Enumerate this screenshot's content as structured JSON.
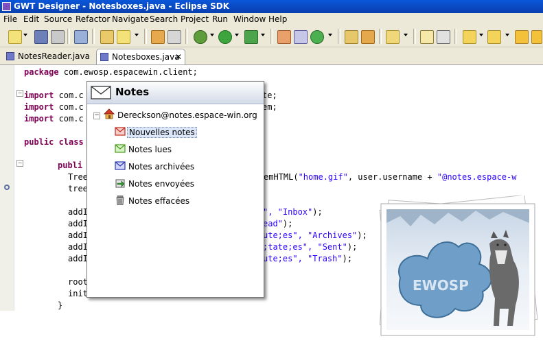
{
  "window": {
    "title": "GWT Designer - Notesboxes.java - Eclipse SDK"
  },
  "menu": [
    "File",
    "Edit",
    "Source",
    "Refactor",
    "Navigate",
    "Search",
    "Project",
    "Run",
    "Window",
    "Help"
  ],
  "tabs": [
    {
      "label": "NotesReader.java",
      "active": false
    },
    {
      "label": "Notesboxes.java",
      "active": true,
      "close": "✕"
    }
  ],
  "code": {
    "l1": {
      "kw": "package",
      "rest": " com.ewosp.espacewin.client;"
    },
    "l2": {
      "kw": "import",
      "rest": " com.c"
    },
    "l2r": "te;",
    "l3": {
      "kw": "import",
      "rest": " com.c"
    },
    "l3r": "em;",
    "l4": {
      "kw": "import",
      "rest": " com.c"
    },
    "l5": {
      "kw": "public",
      "rest": " class"
    },
    "l6": {
      "kw": "publi"
    },
    "l7": {
      "a": "Tree",
      "b": "emHTML(",
      "s1": "\"home.gif\"",
      "c": ", user.username + ",
      "s2": "\"@notes.espace-w"
    },
    "l8": "tree",
    "l9": {
      "a": "addI",
      "s": "\", \"Inbox\"",
      "c": ");"
    },
    "l10": {
      "a": "addI",
      "s": "ead\"",
      "c": ");"
    },
    "l11": {
      "a": "addI",
      "b": "ute;es\", ",
      "s": "\"Archives\"",
      "c": ");"
    },
    "l12": {
      "a": "addI",
      "b": ";tate;es\", ",
      "s": "\"Sent\"",
      "c": ");"
    },
    "l13": {
      "a": "addI",
      "b": "ute;es\", ",
      "s": "\"Trash\"",
      "c": ");"
    },
    "l14": "root",
    "l15": "init",
    "l16": "}"
  },
  "popup": {
    "title": "Notes",
    "root_label": "Dereckson@notes.espace-win.org",
    "toggle": "−",
    "items": [
      {
        "label": "Nouvelles notes",
        "icon": "mail-red-icon",
        "selected": true
      },
      {
        "label": "Notes lues",
        "icon": "mail-green-icon",
        "selected": false
      },
      {
        "label": "Notes archivées",
        "icon": "mail-blue-icon",
        "selected": false
      },
      {
        "label": "Notes envoyées",
        "icon": "outbox-arrow-icon",
        "selected": false
      },
      {
        "label": "Notes effacées",
        "icon": "trash-icon",
        "selected": false
      }
    ]
  },
  "logo": {
    "text": "EWOSP"
  },
  "colors": {
    "keyword": "#7f0055",
    "string": "#2a00ff",
    "titlebar": "#0a4fc8",
    "chrome": "#ece9d8"
  }
}
